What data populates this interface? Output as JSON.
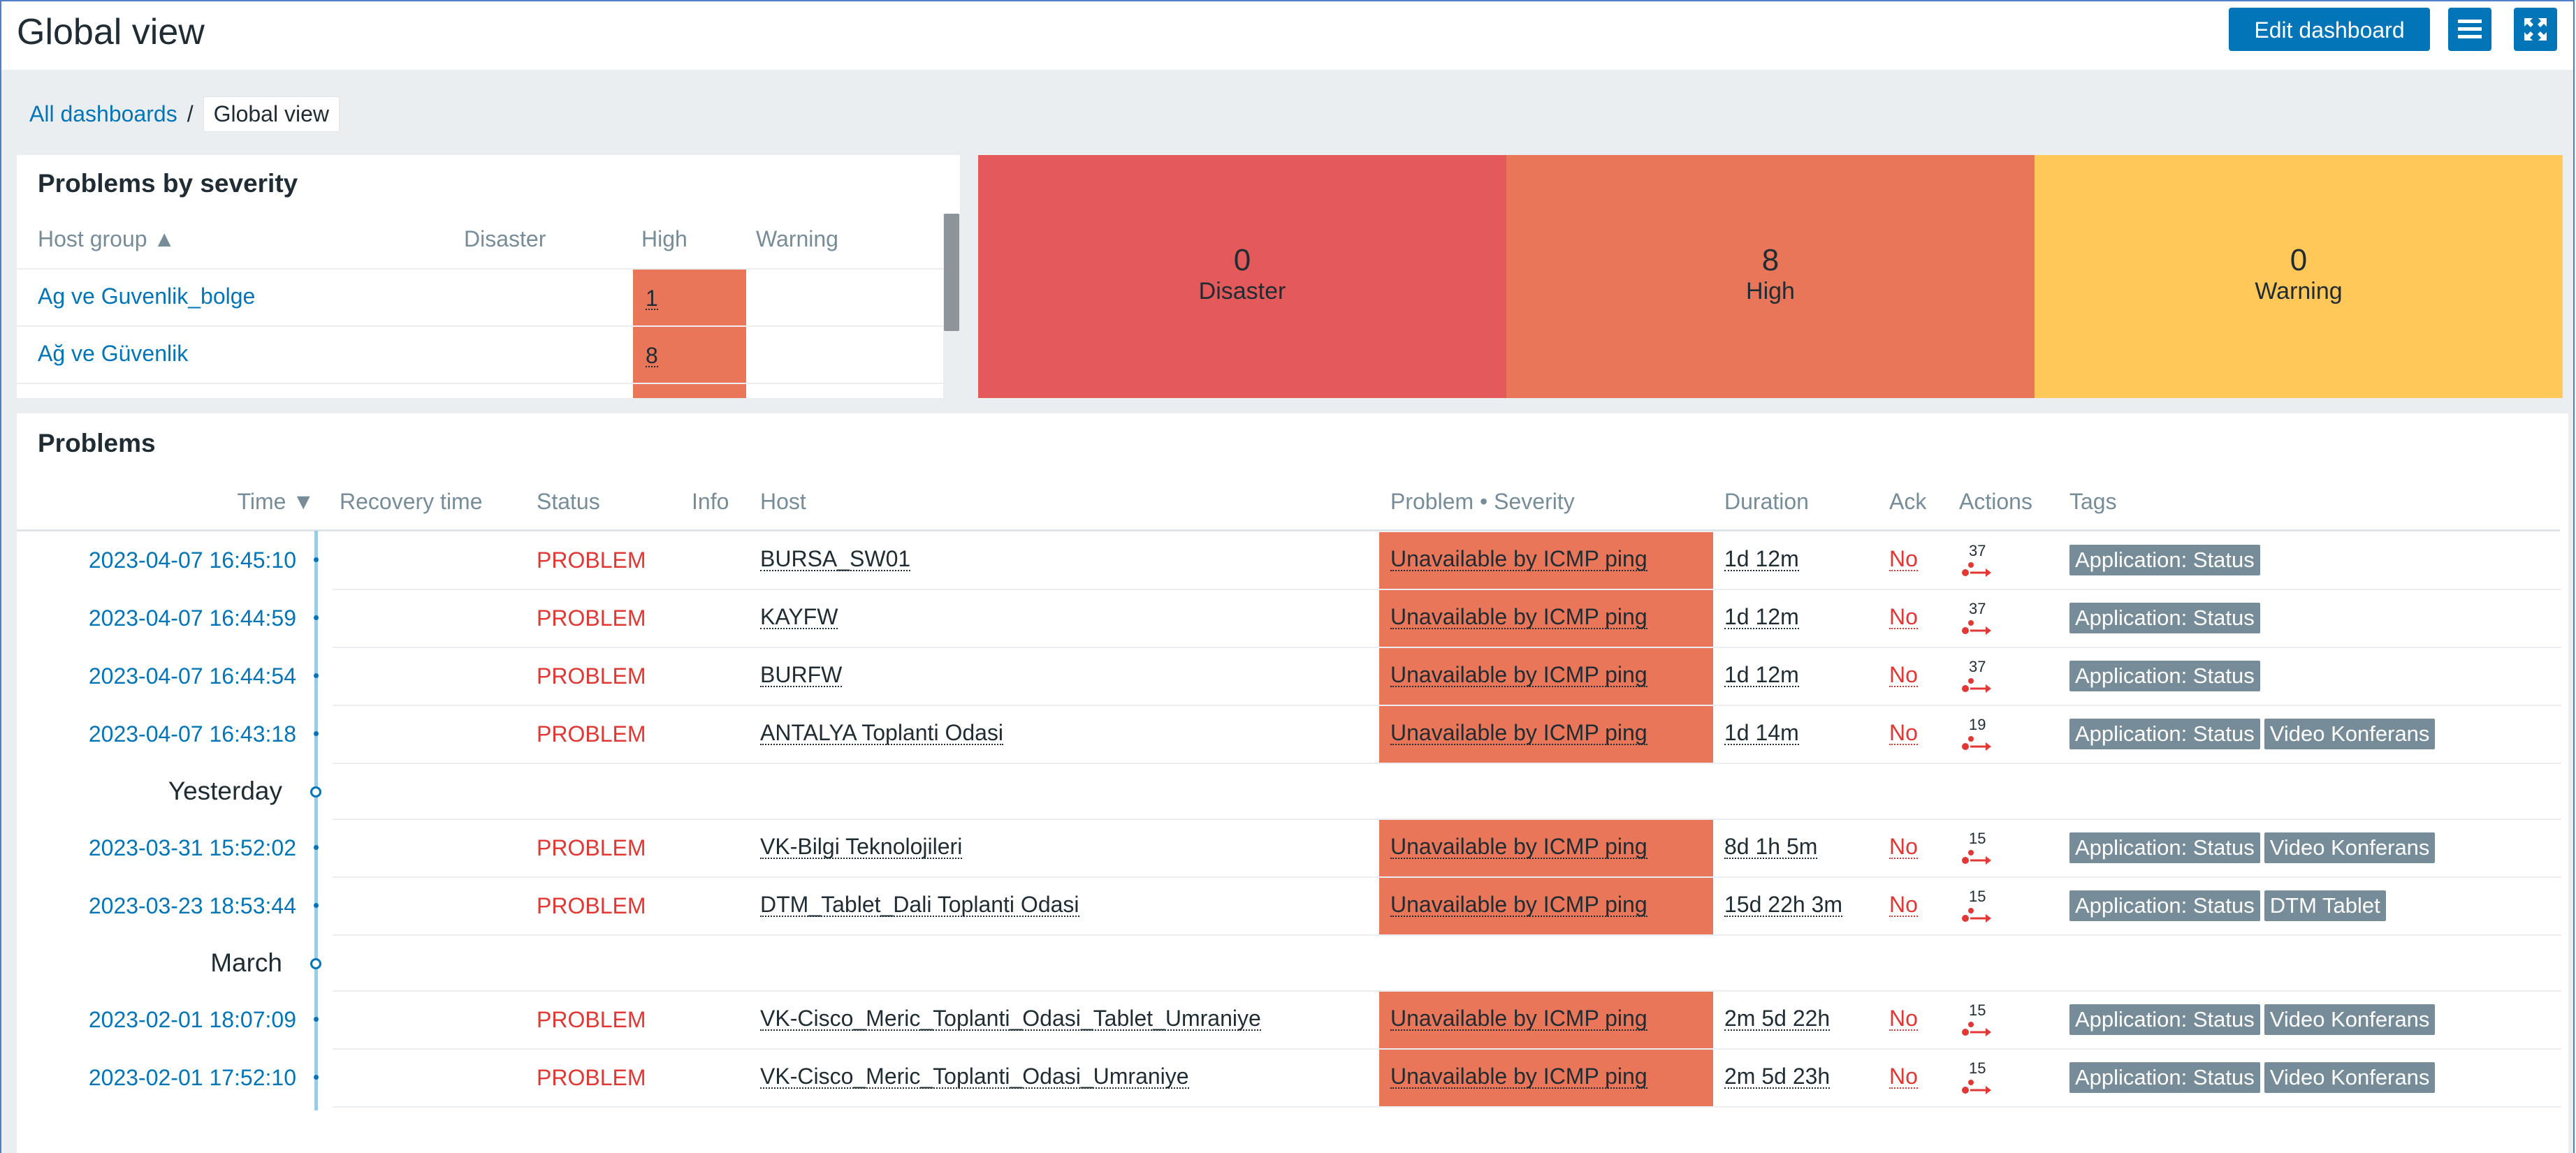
{
  "header": {
    "title": "Global view",
    "edit_label": "Edit dashboard",
    "menu_icon": "hamburger-menu-icon",
    "fullscreen_icon": "fullscreen-icon"
  },
  "breadcrumb": {
    "root": "All dashboards",
    "separator": "/",
    "current": "Global view"
  },
  "problems_by_severity": {
    "title": "Problems by severity",
    "columns": [
      "Host group ▲",
      "Disaster",
      "High",
      "Warning"
    ],
    "rows": [
      {
        "group": "Ag ve Guvenlik_bolge",
        "disaster": "",
        "high": "1",
        "warning": ""
      },
      {
        "group": "Ağ ve Güvenlik",
        "disaster": "",
        "high": "8",
        "warning": ""
      }
    ]
  },
  "severity_tiles": [
    {
      "count": "0",
      "label": "Disaster",
      "color": "#e45959"
    },
    {
      "count": "8",
      "label": "High",
      "color": "#e97659"
    },
    {
      "count": "0",
      "label": "Warning",
      "color": "#ffc859"
    }
  ],
  "problems": {
    "title": "Problems",
    "columns": {
      "time": "Time ▼",
      "recovery": "Recovery time",
      "status": "Status",
      "info": "Info",
      "host": "Host",
      "problem": "Problem • Severity",
      "duration": "Duration",
      "ack": "Ack",
      "actions": "Actions",
      "tags": "Tags"
    },
    "rows": [
      {
        "time": "2023-04-07 16:45:10",
        "status": "PROBLEM",
        "host": "BURSA_SW01",
        "problem": "Unavailable by ICMP ping",
        "duration": "1d 12m",
        "ack": "No",
        "actions": "37",
        "tags": [
          "Application: Status"
        ]
      },
      {
        "time": "2023-04-07 16:44:59",
        "status": "PROBLEM",
        "host": "KAYFW",
        "problem": "Unavailable by ICMP ping",
        "duration": "1d 12m",
        "ack": "No",
        "actions": "37",
        "tags": [
          "Application: Status"
        ]
      },
      {
        "time": "2023-04-07 16:44:54",
        "status": "PROBLEM",
        "host": "BURFW",
        "problem": "Unavailable by ICMP ping",
        "duration": "1d 12m",
        "ack": "No",
        "actions": "37",
        "tags": [
          "Application: Status"
        ]
      },
      {
        "time": "2023-04-07 16:43:18",
        "status": "PROBLEM",
        "host": "ANTALYA Toplanti Odasi",
        "problem": "Unavailable by ICMP ping",
        "duration": "1d 14m",
        "ack": "No",
        "actions": "19",
        "tags": [
          "Application: Status",
          "Video Konferans"
        ]
      },
      {
        "separator": "Yesterday"
      },
      {
        "time": "2023-03-31 15:52:02",
        "status": "PROBLEM",
        "host": "VK-Bilgi Teknolojileri",
        "problem": "Unavailable by ICMP ping",
        "duration": "8d 1h 5m",
        "ack": "No",
        "actions": "15",
        "tags": [
          "Application: Status",
          "Video Konferans"
        ]
      },
      {
        "time": "2023-03-23 18:53:44",
        "status": "PROBLEM",
        "host": "DTM_Tablet_Dali Toplanti Odasi",
        "problem": "Unavailable by ICMP ping",
        "duration": "15d 22h 3m",
        "ack": "No",
        "actions": "15",
        "tags": [
          "Application: Status",
          "DTM Tablet"
        ]
      },
      {
        "separator": "March"
      },
      {
        "time": "2023-02-01 18:07:09",
        "status": "PROBLEM",
        "host": "VK-Cisco_Meric_Toplanti_Odasi_Tablet_Umraniye",
        "problem": "Unavailable by ICMP ping",
        "duration": "2m 5d 22h",
        "ack": "No",
        "actions": "15",
        "tags": [
          "Application: Status",
          "Video Konferans"
        ]
      },
      {
        "time": "2023-02-01 17:52:10",
        "status": "PROBLEM",
        "host": "VK-Cisco_Meric_Toplanti_Odasi_Umraniye",
        "problem": "Unavailable by ICMP ping",
        "duration": "2m 5d 23h",
        "ack": "No",
        "actions": "15",
        "tags": [
          "Application: Status",
          "Video Konferans"
        ]
      }
    ]
  },
  "colors": {
    "accent": "#0275b8",
    "problem_text": "#e33734",
    "high": "#e97659",
    "tag_bg": "#768d99"
  }
}
